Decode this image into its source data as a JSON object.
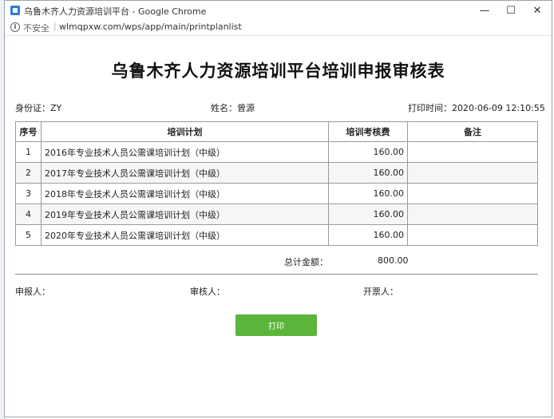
{
  "window": {
    "title": "乌鲁木齐人力资源培训平台 - Google Chrome",
    "controls": {
      "minimize": "—",
      "maximize": "☐",
      "close": "✕"
    }
  },
  "addressbar": {
    "security_label": "不安全",
    "separator": "|",
    "url": "wlmqpxw.com/wps/app/main/printplanlist"
  },
  "doc": {
    "title": "乌鲁木齐人力资源培训平台培训申报审核表",
    "id_line": "身份证：ZY",
    "name_line": "姓名：曾源",
    "print_time": "打印时间：2020-06-09 12:10:55"
  },
  "table": {
    "headers": {
      "no": "序号",
      "plan": "培训计划",
      "fee": "培训考核费",
      "note": "备注"
    },
    "rows": [
      {
        "no": "1",
        "plan": "2016年专业技术人员公需课培训计划（中级）",
        "fee": "160.00",
        "note": ""
      },
      {
        "no": "2",
        "plan": "2017年专业技术人员公需课培训计划（中级）",
        "fee": "160.00",
        "note": ""
      },
      {
        "no": "3",
        "plan": "2018年专业技术人员公需课培训计划（中级）",
        "fee": "160.00",
        "note": ""
      },
      {
        "no": "4",
        "plan": "2019年专业技术人员公需课培训计划（中级）",
        "fee": "160.00",
        "note": ""
      },
      {
        "no": "5",
        "plan": "2020年专业技术人员公需课培训计划（中级）",
        "fee": "160.00",
        "note": ""
      }
    ]
  },
  "summary": {
    "total_label": "总计金额：",
    "total_value": "800.00"
  },
  "signatures": {
    "applicant": "申报人：",
    "reviewer": "审核人：",
    "issuer": "开票人："
  },
  "actions": {
    "print_label": "打印"
  },
  "colors": {
    "print_button": "#5cb53b",
    "app_icon": "#2b7bd6"
  }
}
